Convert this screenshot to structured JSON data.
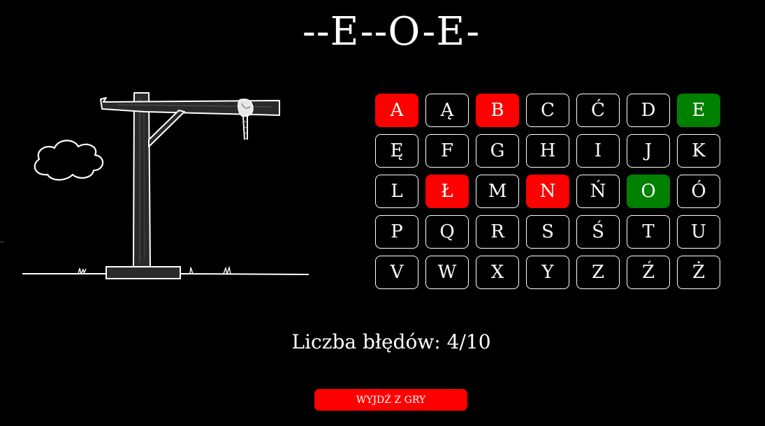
{
  "game": {
    "word_pattern": "--E--O-E-",
    "errors_label": "Liczba błędów:",
    "errors_count": "4/10",
    "mistakes": 4,
    "max_mistakes": 10,
    "exit_label": "WYJDŹ Z GRY"
  },
  "colors": {
    "background": "#000000",
    "text": "#ffffff",
    "wrong": "#ff0000",
    "correct": "#008000",
    "exit_button": "#ff0000"
  },
  "keyboard": [
    {
      "letter": "A",
      "state": "wrong"
    },
    {
      "letter": "Ą",
      "state": "unused"
    },
    {
      "letter": "B",
      "state": "wrong"
    },
    {
      "letter": "C",
      "state": "unused"
    },
    {
      "letter": "Ć",
      "state": "unused"
    },
    {
      "letter": "D",
      "state": "unused"
    },
    {
      "letter": "E",
      "state": "correct"
    },
    {
      "letter": "Ę",
      "state": "unused"
    },
    {
      "letter": "F",
      "state": "unused"
    },
    {
      "letter": "G",
      "state": "unused"
    },
    {
      "letter": "H",
      "state": "unused"
    },
    {
      "letter": "I",
      "state": "unused"
    },
    {
      "letter": "J",
      "state": "unused"
    },
    {
      "letter": "K",
      "state": "unused"
    },
    {
      "letter": "L",
      "state": "unused"
    },
    {
      "letter": "Ł",
      "state": "wrong"
    },
    {
      "letter": "M",
      "state": "unused"
    },
    {
      "letter": "N",
      "state": "wrong"
    },
    {
      "letter": "Ń",
      "state": "unused"
    },
    {
      "letter": "O",
      "state": "correct"
    },
    {
      "letter": "Ó",
      "state": "unused"
    },
    {
      "letter": "P",
      "state": "unused"
    },
    {
      "letter": "Q",
      "state": "unused"
    },
    {
      "letter": "R",
      "state": "unused"
    },
    {
      "letter": "S",
      "state": "unused"
    },
    {
      "letter": "Ś",
      "state": "unused"
    },
    {
      "letter": "T",
      "state": "unused"
    },
    {
      "letter": "U",
      "state": "unused"
    },
    {
      "letter": "V",
      "state": "unused"
    },
    {
      "letter": "W",
      "state": "unused"
    },
    {
      "letter": "X",
      "state": "unused"
    },
    {
      "letter": "Y",
      "state": "unused"
    },
    {
      "letter": "Z",
      "state": "unused"
    },
    {
      "letter": "Ź",
      "state": "unused"
    },
    {
      "letter": "Ż",
      "state": "unused"
    }
  ],
  "drawing": {
    "parts_visible": [
      "ground",
      "base",
      "post",
      "beam",
      "brace",
      "rope",
      "cloud"
    ]
  }
}
